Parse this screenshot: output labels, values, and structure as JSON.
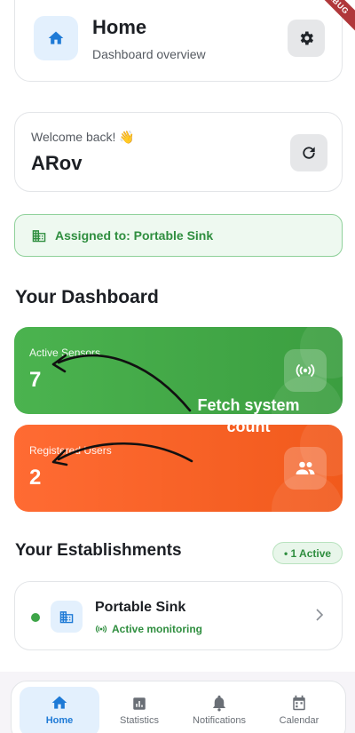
{
  "header": {
    "title": "Home",
    "subtitle": "Dashboard overview",
    "home_icon": "home-icon",
    "settings_icon": "gear-icon",
    "debug_banner": "DEBUG"
  },
  "welcome": {
    "label": "Welcome back! 👋",
    "name": "ARov",
    "refresh_icon": "refresh-icon"
  },
  "assigned": {
    "icon": "building-icon",
    "text": "Assigned to: Portable Sink"
  },
  "dashboard": {
    "title": "Your Dashboard",
    "stats": [
      {
        "label": "Active Sensors",
        "value": "7",
        "icon": "sensor-signal-icon",
        "color": "#43a847"
      },
      {
        "label": "Registered Users",
        "value": "2",
        "icon": "users-icon",
        "color": "#f8622a"
      }
    ]
  },
  "annotation": {
    "text": "Fetch system count"
  },
  "establishments": {
    "title": "Your Establishments",
    "badge": "• 1 Active",
    "items": [
      {
        "name": "Portable Sink",
        "status": "Active monitoring",
        "icon": "building-icon",
        "status_icon": "signal-icon"
      }
    ]
  },
  "nav": {
    "items": [
      {
        "label": "Home",
        "icon": "home-icon",
        "active": true
      },
      {
        "label": "Statistics",
        "icon": "chart-icon",
        "active": false
      },
      {
        "label": "Notifications",
        "icon": "bell-icon",
        "active": false
      },
      {
        "label": "Calendar",
        "icon": "calendar-icon",
        "active": false
      }
    ]
  },
  "colors": {
    "accent_blue": "#1e7ad6",
    "green": "#43a847",
    "orange": "#f8622a"
  }
}
